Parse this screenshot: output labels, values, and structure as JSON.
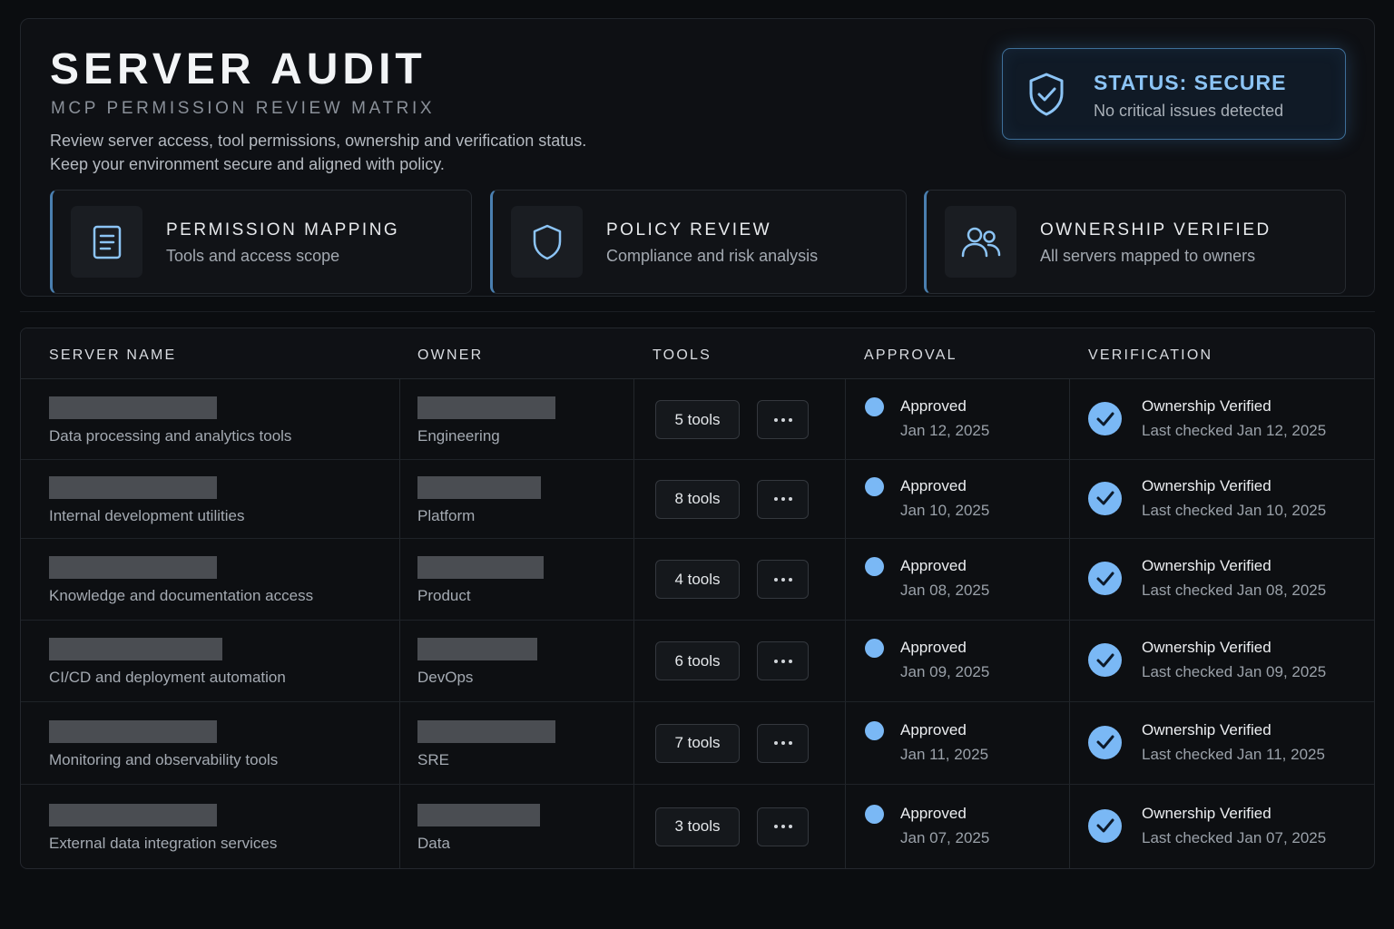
{
  "header": {
    "title": "SERVER AUDIT",
    "subtitle": "MCP PERMISSION REVIEW MATRIX",
    "description_line1": "Review server access, tool permissions, ownership and verification status.",
    "description_line2": "Keep your environment secure and aligned with policy."
  },
  "status": {
    "title": "STATUS: SECURE",
    "subtitle": "No critical issues detected",
    "icon": "shield-check-icon",
    "accent": "#8cc4f5"
  },
  "features": [
    {
      "title": "PERMISSION MAPPING",
      "subtitle": "Tools and access scope",
      "icon": "document-icon"
    },
    {
      "title": "POLICY REVIEW",
      "subtitle": "Compliance and risk analysis",
      "icon": "shield-icon"
    },
    {
      "title": "OWNERSHIP VERIFIED",
      "subtitle": "All servers mapped to owners",
      "icon": "users-icon"
    }
  ],
  "table": {
    "columns": [
      "SERVER NAME",
      "OWNER",
      "TOOLS",
      "APPROVAL",
      "VERIFICATION"
    ],
    "rows": [
      {
        "description": "Data processing and analytics tools",
        "owner": "Engineering",
        "tools": "5 tools",
        "approval": "Approved",
        "approval_date": "Jan 12, 2025",
        "verification": "Ownership Verified",
        "verification_date": "Last checked Jan 12, 2025"
      },
      {
        "description": "Internal development utilities",
        "owner": "Platform",
        "tools": "8 tools",
        "approval": "Approved",
        "approval_date": "Jan 10, 2025",
        "verification": "Ownership Verified",
        "verification_date": "Last checked Jan 10, 2025"
      },
      {
        "description": "Knowledge and documentation access",
        "owner": "Product",
        "tools": "4 tools",
        "approval": "Approved",
        "approval_date": "Jan 08, 2025",
        "verification": "Ownership Verified",
        "verification_date": "Last checked Jan 08, 2025"
      },
      {
        "description": "CI/CD and deployment automation",
        "owner": "DevOps",
        "tools": "6 tools",
        "approval": "Approved",
        "approval_date": "Jan 09, 2025",
        "verification": "Ownership Verified",
        "verification_date": "Last checked Jan 09, 2025"
      },
      {
        "description": "Monitoring and observability tools",
        "owner": "SRE",
        "tools": "7 tools",
        "approval": "Approved",
        "approval_date": "Jan 11, 2025",
        "verification": "Ownership Verified",
        "verification_date": "Last checked Jan 11, 2025"
      },
      {
        "description": "External data integration services",
        "owner": "Data",
        "tools": "3 tools",
        "approval": "Approved",
        "approval_date": "Jan 07, 2025",
        "verification": "Ownership Verified",
        "verification_date": "Last checked Jan 07, 2025"
      }
    ],
    "more_label": "···",
    "approval_color": "#7ab8f5",
    "verified_color": "#7ab8f5"
  }
}
